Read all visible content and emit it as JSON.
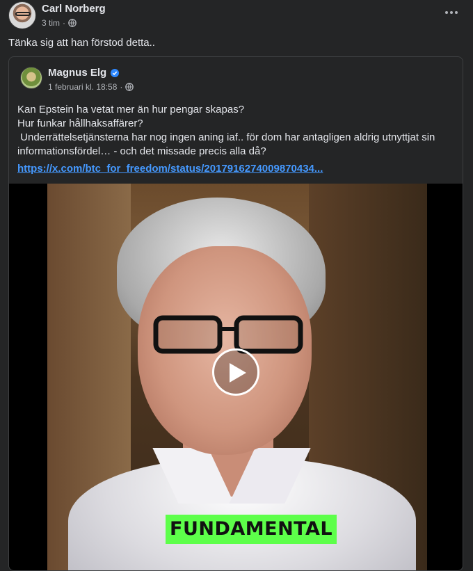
{
  "post": {
    "author": "Carl Norberg",
    "time": "3 tim",
    "separator": "·",
    "text": "Tänka sig att han förstod detta.."
  },
  "shared": {
    "author": "Magnus Elg",
    "date": "1 februari kl. 18:58",
    "separator": "·",
    "lines": [
      "Kan Epstein ha vetat mer än hur pengar skapas?",
      "Hur funkar hållhaksaffärer?",
      " Underrättelsetjänsterna har nog ingen aning iaf.. för dom har antagligen aldrig utnyttjat sin",
      "informationsfördel… - och det missade precis alla då?"
    ],
    "link": "https://x.com/btc_for_freedom/status/2017916274009870434...",
    "video_caption": "FUNDAMENTAL"
  },
  "colors": {
    "background": "#242526",
    "text": "#e4e6eb",
    "muted": "#b0b3b8",
    "link": "#4599ff",
    "verified": "#2d88ff",
    "caption_bg": "#5dff4a"
  },
  "icons": [
    "globe-icon",
    "more-icon",
    "verified-badge-icon",
    "play-icon"
  ]
}
